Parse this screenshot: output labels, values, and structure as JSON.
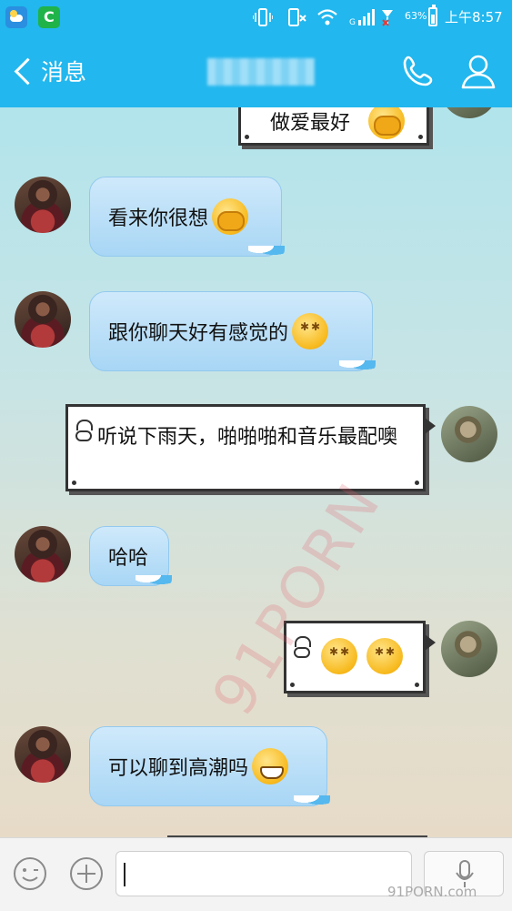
{
  "status_bar": {
    "battery_percent": "63%",
    "time": "上午8:57"
  },
  "nav": {
    "back_label": "消息"
  },
  "messages": [
    {
      "side": "out",
      "text": "做爱最好"
    },
    {
      "side": "in",
      "text": "看来你很想"
    },
    {
      "side": "in",
      "text": "跟你聊天好有感觉的"
    },
    {
      "side": "out",
      "text": "听说下雨天，啪啪啪和音乐最配噢"
    },
    {
      "side": "in",
      "text": "哈哈"
    },
    {
      "side": "out",
      "text": ""
    },
    {
      "side": "in",
      "text": "可以聊到高潮吗"
    }
  ],
  "watermark": "91PORN",
  "watermark_footer": "91PORN.com",
  "icons": {
    "status": [
      "weather-app-icon",
      "green-app-icon",
      "vibrate-icon",
      "mute-icon",
      "wifi-icon",
      "signal-icon",
      "battery-icon"
    ],
    "nav": [
      "back-chevron-icon",
      "phone-icon",
      "person-icon"
    ],
    "input": [
      "emoji-icon",
      "plus-icon",
      "microphone-icon"
    ]
  },
  "colors": {
    "header": "#22b7ee",
    "incoming_bubble": "#a8d6f5"
  }
}
